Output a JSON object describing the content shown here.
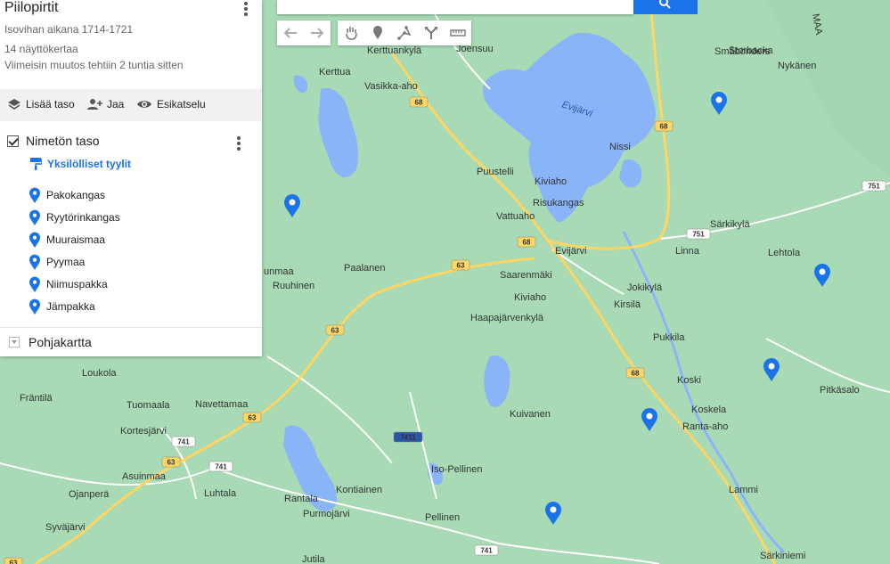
{
  "map": {
    "title": "Piilopirtit",
    "subtitle": "Isovihan aikana 1714-1721",
    "views": "14 näyttökertaa",
    "last_modified": "Viimeisin muutos tehtiin 2 tuntia sitten",
    "actions": {
      "add_layer": "Lisää taso",
      "share": "Jaa",
      "preview": "Esikatselu"
    },
    "layer": {
      "name": "Nimetön taso",
      "styles_link": "Yksilölliset tyylit",
      "places": [
        "Pakokangas",
        "Ryytörinkangas",
        "Muuraismaa",
        "Pyymaa",
        "Niimuspakka",
        "Jämpakka"
      ]
    },
    "basemap_label": "Pohjakartta"
  },
  "tools": [
    "undo-icon",
    "redo-icon",
    "hand-icon",
    "marker-icon",
    "line-icon",
    "directions-icon",
    "ruler-icon"
  ],
  "colors": {
    "land": "#a8dab5",
    "water": "#8ab4f8",
    "road_major": "#fdd663",
    "road_minor": "#ffffff",
    "marker": "#1a73e8",
    "accent": "#1a73e8"
  },
  "labels": {
    "lake": "Evijärvi",
    "places": [
      "Storbacka",
      "Småbönders",
      "Nykänen",
      "Kerttua",
      "Kerttuankylä",
      "Joensuu",
      "Vasikka-aho",
      "Nissi",
      "Puustelli",
      "Kiviaho",
      "Risukangas",
      "Vattuaho",
      "Evijärvi",
      "Särkikylä",
      "Lehtola",
      "Linna",
      "Saarenmäki",
      "Kiviaho",
      "Jokikylä",
      "Kirsilä",
      "Haapajärvenkylä",
      "Paalanen",
      "Ruuhinen",
      "Pukkila",
      "Koski",
      "Pitkäsalo",
      "Koskela",
      "Ranta-aho",
      "Kuivanen",
      "Loukola",
      "Fräntilä",
      "Tuomaala",
      "Navettamaa",
      "Kortesjärvi",
      "Asuinmaa",
      "Luhtala",
      "Ojanperä",
      "Syväjärvi",
      "Rantala",
      "Kontiainen",
      "Purmojärvi",
      "Iso-Pellinen",
      "Pellinen",
      "Lammi",
      "Jutila",
      "Särkiniemi",
      "MAA",
      "unmaa"
    ],
    "roads": [
      "68",
      "68",
      "68",
      "68",
      "63",
      "63",
      "63",
      "63",
      "63",
      "751",
      "751",
      "741",
      "741",
      "741",
      "741",
      "7411"
    ]
  }
}
